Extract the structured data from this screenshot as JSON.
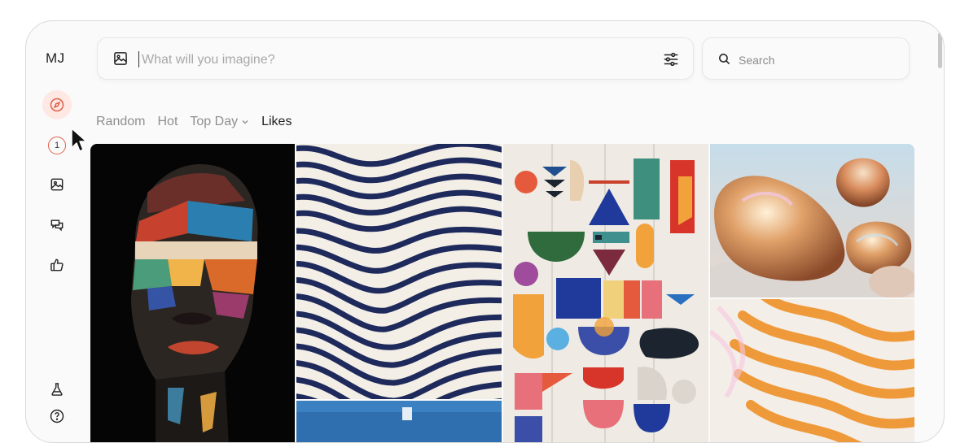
{
  "app": {
    "logo": "MJ"
  },
  "sidebar": {
    "items": [
      {
        "name": "explore",
        "icon": "compass-icon"
      },
      {
        "name": "tasks",
        "icon": "badge-count",
        "badge": "1"
      },
      {
        "name": "create",
        "icon": "image-icon"
      },
      {
        "name": "chat",
        "icon": "chat-bubbles-icon"
      },
      {
        "name": "likes",
        "icon": "thumbs-up-icon"
      },
      {
        "name": "labs",
        "icon": "flask-icon"
      },
      {
        "name": "help",
        "icon": "help-icon"
      }
    ]
  },
  "prompt": {
    "placeholder": "What will you imagine?",
    "value": ""
  },
  "search": {
    "placeholder": "Search",
    "value": ""
  },
  "tabs": [
    {
      "label": "Random",
      "active": false
    },
    {
      "label": "Hot",
      "active": false
    },
    {
      "label": "Top Day",
      "active": false,
      "dropdown": true
    },
    {
      "label": "Likes",
      "active": true
    }
  ],
  "colors": {
    "accent": "#e0604a",
    "active_bg": "#fde8e4",
    "text": "#222222",
    "muted": "#8f8f8f"
  }
}
